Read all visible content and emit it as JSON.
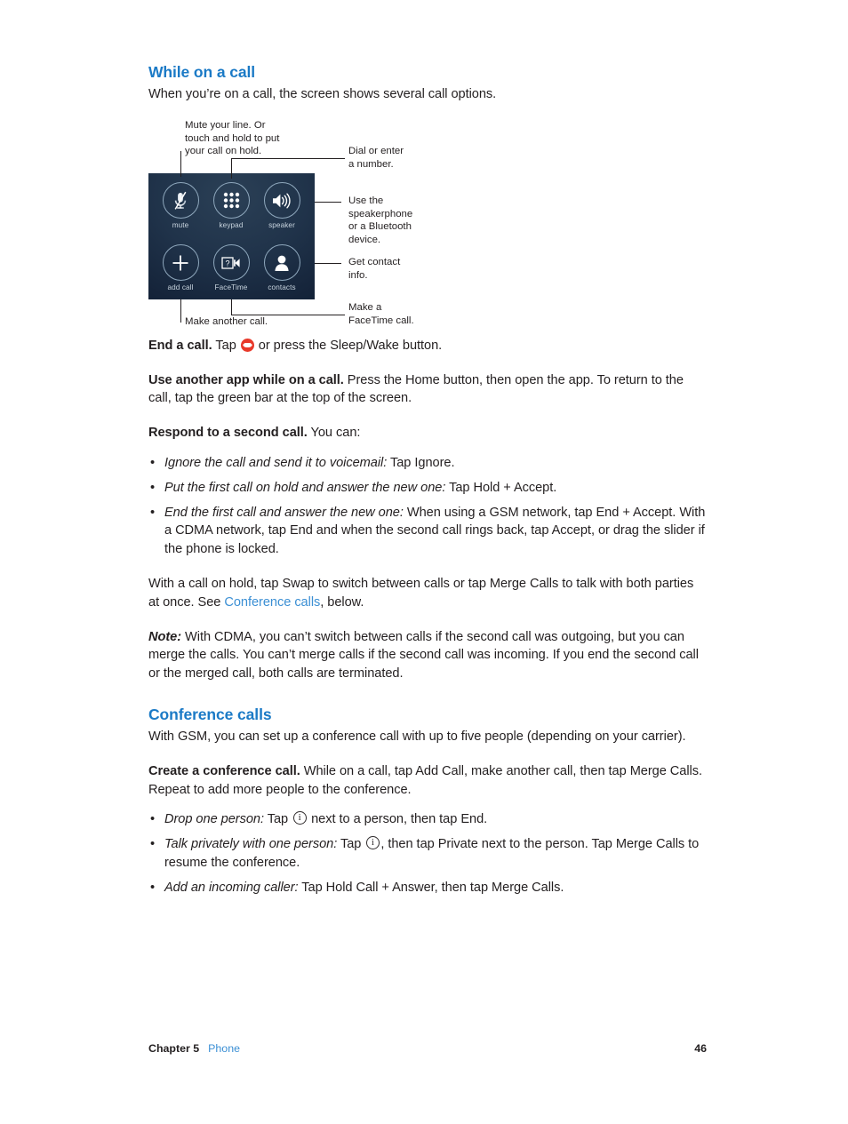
{
  "section1": {
    "heading": "While on a call",
    "intro": "When you’re on a call, the screen shows several call options."
  },
  "figure": {
    "buttons": [
      {
        "name": "mute",
        "label": "mute",
        "icon": "microphone-muted-icon"
      },
      {
        "name": "keypad",
        "label": "keypad",
        "icon": "keypad-grid-icon"
      },
      {
        "name": "speaker",
        "label": "speaker",
        "icon": "speaker-waves-icon"
      },
      {
        "name": "add-call",
        "label": "add call",
        "icon": "plus-icon"
      },
      {
        "name": "facetime",
        "label": "FaceTime",
        "icon": "video-camera-icon"
      },
      {
        "name": "contacts",
        "label": "contacts",
        "icon": "person-silhouette-icon"
      }
    ],
    "callouts": {
      "mute": "Mute your line. Or\ntouch and hold to put\nyour call on hold.",
      "keypad": "Dial or enter\na number.",
      "speaker": "Use the\nspeakerphone\nor a Bluetooth\ndevice.",
      "contacts": "Get contact\ninfo.",
      "add_call": "Make another call.",
      "facetime": "Make a\nFaceTime call."
    }
  },
  "body": {
    "end_a_call": {
      "lead": "End a call.",
      "text_before_icon": " Tap ",
      "text_after_icon": " or press the Sleep/Wake button."
    },
    "use_another_app": {
      "lead": "Use another app while on a call.",
      "text": " Press the Home button, then open the app. To return to the call, tap the green bar at the top of the screen."
    },
    "respond_second_call": {
      "lead": "Respond to a second call.",
      "text": " You can:"
    },
    "respond_bullets": [
      {
        "lead": "Ignore the call and send it to voicemail:",
        "text": "  Tap Ignore."
      },
      {
        "lead": "Put the first call on hold and answer the new one:",
        "text": "  Tap Hold + Accept."
      },
      {
        "lead": "End the first call and answer the new one:",
        "text": "  When using a GSM network, tap End + Accept. With a CDMA network, tap End and when the second call rings back, tap Accept, or drag the slider if the phone is locked."
      }
    ],
    "swap_para": {
      "before_link": "With a call on hold, tap Swap to switch between calls or tap Merge Calls to talk with both parties at once. See ",
      "link": "Conference calls",
      "after_link": ", below."
    },
    "note": {
      "lead": "Note:",
      "text": "  With CDMA, you can’t switch between calls if the second call was outgoing, but you can merge the calls. You can’t merge calls if the second call was incoming. If you end the second call or the merged call, both calls are terminated."
    }
  },
  "section2": {
    "heading": "Conference calls",
    "intro": "With GSM, you can set up a conference call with up to five people (depending on your carrier).",
    "create": {
      "lead": "Create a conference call.",
      "text": " While on a call, tap Add Call, make another call, then tap Merge Calls. Repeat to add more people to the conference."
    },
    "bullets": [
      {
        "lead": "Drop one person:",
        "mid": "  Tap ",
        "tail": " next to a person, then tap End."
      },
      {
        "lead": "Talk privately with one person:",
        "mid": "  Tap ",
        "tail": ", then tap Private next to the person. Tap Merge Calls to resume the conference."
      },
      {
        "lead": "Add an incoming caller:",
        "mid": "  Tap Hold Call + Answer, then tap Merge Calls.",
        "tail": ""
      }
    ]
  },
  "footer": {
    "chapter": "Chapter  5",
    "chapter_link": "Phone",
    "page_number": "46"
  },
  "colors": {
    "heading_blue": "#1b7ac6",
    "link_blue": "#3b8fd4",
    "text": "#231f20",
    "end_call_red": "#e8392a",
    "panel_dark": "#15243a"
  }
}
